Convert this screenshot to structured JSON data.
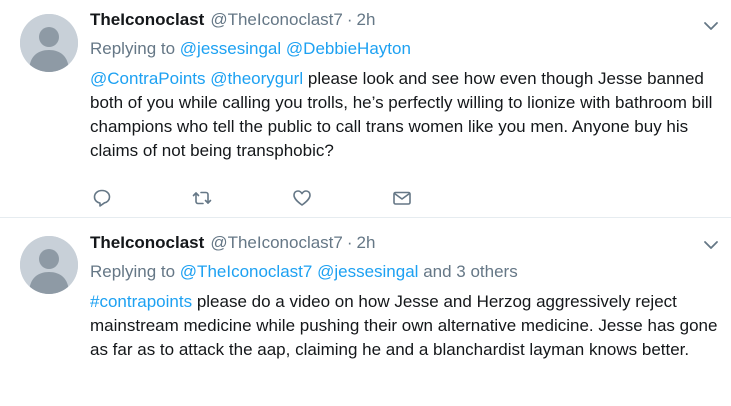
{
  "tweets": [
    {
      "display_name": "TheIconoclast",
      "handle": "@TheIconoclast7",
      "separator": "·",
      "time": "2h",
      "replying_label": "Replying to",
      "replying_to": [
        "@jessesingal",
        "@DebbieHayton"
      ],
      "replying_others": "",
      "mentions": [
        "@ContraPoints",
        "@theorygurl"
      ],
      "text": "please look and see how even though Jesse banned both of you while calling you trolls, he’s perfectly willing to lionize with bathroom bill champions who tell the public to call trans women like you men. Anyone buy his claims of not being transphobic?",
      "actions": [
        "reply-icon",
        "retweet-icon",
        "like-icon",
        "direct-message-icon"
      ]
    },
    {
      "display_name": "TheIconoclast",
      "handle": "@TheIconoclast7",
      "separator": "·",
      "time": "2h",
      "replying_label": "Replying to",
      "replying_to": [
        "@TheIconoclast7",
        "@jessesingal"
      ],
      "replying_others": "and 3 others",
      "hashtag": "#contrapoints",
      "text": "please do a video on how Jesse and Herzog aggressively reject mainstream medicine while pushing their own alternative medicine. Jesse has gone as far as to attack the aap, claiming he and a blanchardist layman knows better."
    }
  ],
  "colors": {
    "link": "#1da1f2",
    "secondary_text": "#657786",
    "primary_text": "#14171a",
    "divider": "#e6ecf0",
    "avatar_bg": "#c8d0d8",
    "avatar_fg": "#8e9aa5"
  }
}
